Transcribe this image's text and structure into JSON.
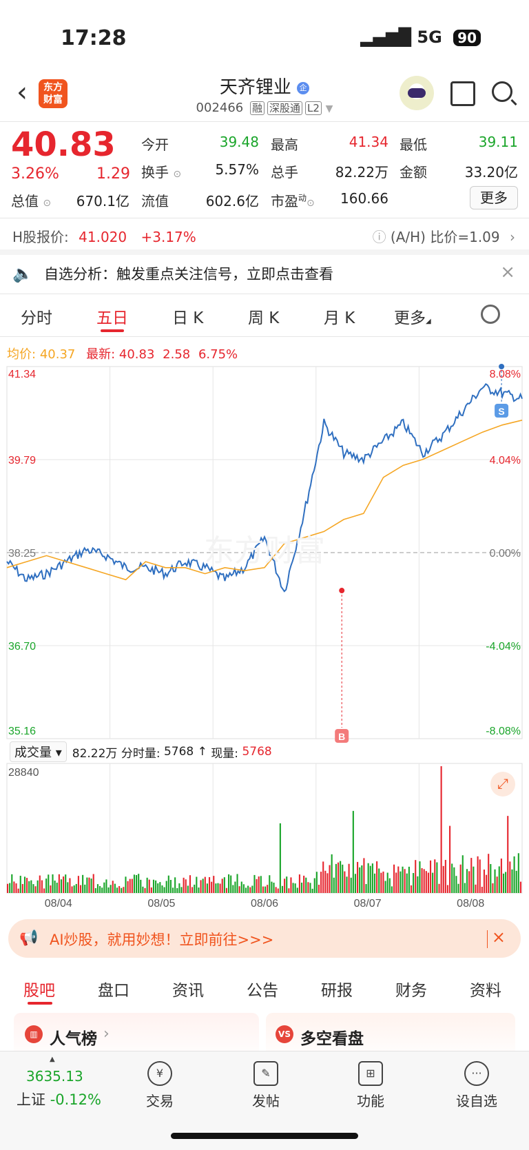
{
  "status": {
    "time": "17:28",
    "network": "5G",
    "battery": "90"
  },
  "header": {
    "logo_line1": "东方",
    "logo_line2": "财富",
    "name": "天齐锂业",
    "code": "002466",
    "tags": [
      "融",
      "深股通",
      "L2"
    ]
  },
  "quote": {
    "price": "40.83",
    "change_pct": "3.26%",
    "change": "1.29",
    "open_label": "今开",
    "open": "39.48",
    "high_label": "最高",
    "high": "41.34",
    "low_label": "最低",
    "low": "39.11",
    "turnover_label": "换手",
    "turnover": "5.57%",
    "volume_label": "总手",
    "volume": "82.22万",
    "amount_label": "金额",
    "amount": "33.20亿",
    "mktcap_label": "总值",
    "mktcap": "670.1亿",
    "float_label": "流值",
    "float": "602.6亿",
    "pe_label": "市盈",
    "pe_sup": "动",
    "pe": "160.66",
    "more": "更多"
  },
  "hshare": {
    "label": "H股报价:",
    "price": "41.020",
    "pct": "+3.17%",
    "ratio": "(A/H) 比价=1.09"
  },
  "notice": {
    "text": "自选分析：触发重点关注信号，立即点击查看"
  },
  "chart_tabs": [
    "分时",
    "五日",
    "日 K",
    "周 K",
    "月 K",
    "更多"
  ],
  "info_line": {
    "avg_label": "均价:",
    "avg": "40.37",
    "last_label": "最新:",
    "last": "40.83",
    "chg": "2.58",
    "pct": "6.75%"
  },
  "chart_data": {
    "type": "line",
    "x": [
      "08/04",
      "08/05",
      "08/06",
      "08/07",
      "08/08"
    ],
    "y_ticks_left": [
      "41.34",
      "39.79",
      "38.25",
      "36.70",
      "35.16"
    ],
    "y_ticks_right": [
      "8.08%",
      "4.04%",
      "0.00%",
      "-4.04%",
      "-8.08%"
    ],
    "ylim": [
      35.16,
      41.34
    ],
    "prev_close": 38.25,
    "series": [
      {
        "values": [
          38.1,
          37.8,
          37.9,
          38.1,
          38.3,
          38.2,
          38.0,
          38.0,
          37.9,
          38.1,
          38.0,
          37.8,
          38.0,
          38.5,
          37.6,
          38.9,
          40.4,
          39.9,
          39.8,
          40.1,
          40.4,
          39.9,
          40.2,
          40.6,
          41.0,
          40.9,
          40.8
        ]
      },
      {
        "values": [
          38.0,
          38.1,
          38.2,
          38.1,
          38.0,
          37.9,
          37.8,
          38.1,
          38.0,
          38.0,
          37.9,
          38.0,
          37.95,
          38.0,
          38.4,
          38.5,
          38.6,
          38.8,
          38.9,
          39.5,
          39.7,
          39.8,
          39.95,
          40.1,
          40.25,
          40.37,
          40.45
        ]
      }
    ],
    "markers": [
      {
        "label": "B",
        "value": 37.62
      },
      {
        "label": "S",
        "value": 41.34
      }
    ],
    "volume": {
      "label": "成交量",
      "total": "82.22万",
      "tick_label": "分时量:",
      "tick": "5768",
      "now_label": "现量:",
      "now": "5768",
      "max": "28840"
    }
  },
  "ad": {
    "text": "AI炒股，就用妙想！立即前往>>>"
  },
  "info_tabs": [
    "股吧",
    "盘口",
    "资讯",
    "公告",
    "研报",
    "财务",
    "资料"
  ],
  "cards": {
    "left": "人气榜",
    "right": "多空看盘"
  },
  "bottom": {
    "index_value": "3635.13",
    "index_name": "上证",
    "index_chg": "-0.12%",
    "nav": [
      "交易",
      "发帖",
      "功能",
      "设自选"
    ]
  },
  "colors": {
    "rise": "#e6262e",
    "fall": "#1aa52a",
    "price_line": "#2f6fc0",
    "avg_line": "#f5a623",
    "brand": "#f0541e"
  }
}
